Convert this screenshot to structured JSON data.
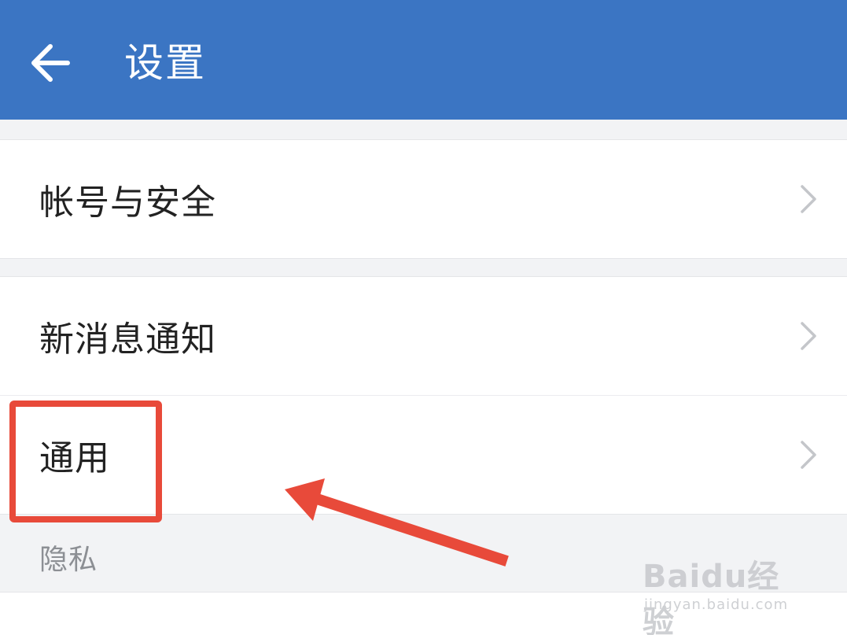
{
  "header": {
    "title": "设置",
    "back_icon": "arrow-left-icon",
    "background_color": "#3b75c3"
  },
  "groups": [
    {
      "items": [
        {
          "label": "帐号与安全",
          "icon": "chevron-right-icon"
        }
      ]
    },
    {
      "items": [
        {
          "label": "新消息通知",
          "icon": "chevron-right-icon"
        },
        {
          "label": "通用",
          "icon": "chevron-right-icon"
        }
      ]
    }
  ],
  "section": {
    "privacy_label": "隐私"
  },
  "annotation": {
    "highlight_color": "#e84a3a"
  },
  "watermark": {
    "brand": "Baidu经验",
    "url": "jingyan.baidu.com"
  }
}
